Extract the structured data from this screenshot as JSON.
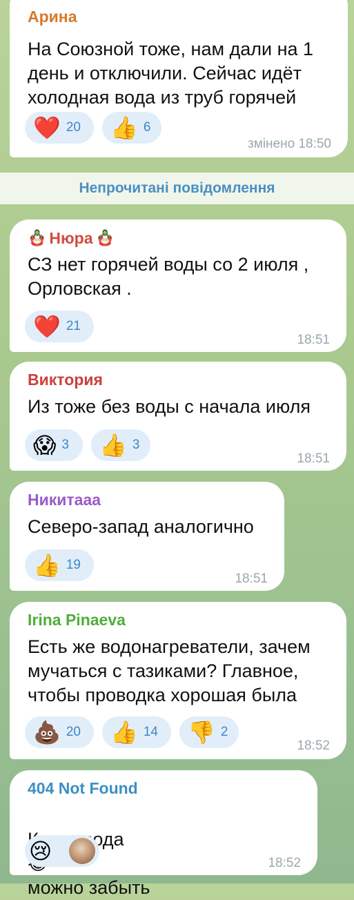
{
  "messages": [
    {
      "sender": "Арина",
      "sender_color": "#d6792b",
      "text": "На Союзной тоже, нам дали на 1 день и отключили. Сейчас идёт холодная вода из труб горячей",
      "reactions": [
        {
          "emoji": "❤️",
          "count": "20",
          "icon": "heart-icon"
        },
        {
          "emoji": "👍",
          "count": "6",
          "icon": "thumbs-up-icon"
        }
      ],
      "time": "змінено 18:50"
    },
    {
      "sender": "Нюра",
      "sender_prefix": "🪆",
      "sender_suffix": "🪆",
      "sender_color": "#d14b40",
      "text": "СЗ нет горячей воды со 2 июля , Орловская .",
      "reactions": [
        {
          "emoji": "❤️",
          "count": "21",
          "icon": "heart-icon"
        }
      ],
      "time": "18:51"
    },
    {
      "sender": "Виктория",
      "sender_color": "#c9413e",
      "text": "Из тоже без воды с начала июля",
      "reactions": [
        {
          "emoji": "😱",
          "count": "3",
          "icon": "scream-face-icon"
        },
        {
          "emoji": "👍",
          "count": "3",
          "icon": "thumbs-up-icon"
        }
      ],
      "time": "18:51"
    },
    {
      "sender": "Никитааа",
      "sender_color": "#9a5bc9",
      "text": "Северо-запад аналогично",
      "reactions": [
        {
          "emoji": "👍",
          "count": "19",
          "icon": "thumbs-up-icon"
        }
      ],
      "time": "18:51"
    },
    {
      "sender": "Irina Pinaeva",
      "sender_color": "#4fae3a",
      "text": "Есть же водонагреватели, зачем мучаться с тазиками? Главное, чтобы проводка хорошая была",
      "reactions": [
        {
          "emoji": "💩",
          "count": "20",
          "icon": "poop-icon"
        },
        {
          "emoji": "👍",
          "count": "14",
          "icon": "thumbs-up-icon"
        },
        {
          "emoji": "👎",
          "count": "2",
          "icon": "thumbs-down-icon"
        }
      ],
      "time": "18:52"
    },
    {
      "sender": "404 Not Found",
      "sender_color": "#3d8fc4",
      "text_before": "Какая вода",
      "text_emoji": "😂",
      "text_after": "можно забыть",
      "reactions": [
        {
          "emoji": "😢",
          "icon": "crying-face-icon"
        },
        {
          "emoji": "👤",
          "icon": "avatar"
        }
      ],
      "time": "18:52"
    }
  ],
  "unread_label": "Непрочитані повідомлення"
}
